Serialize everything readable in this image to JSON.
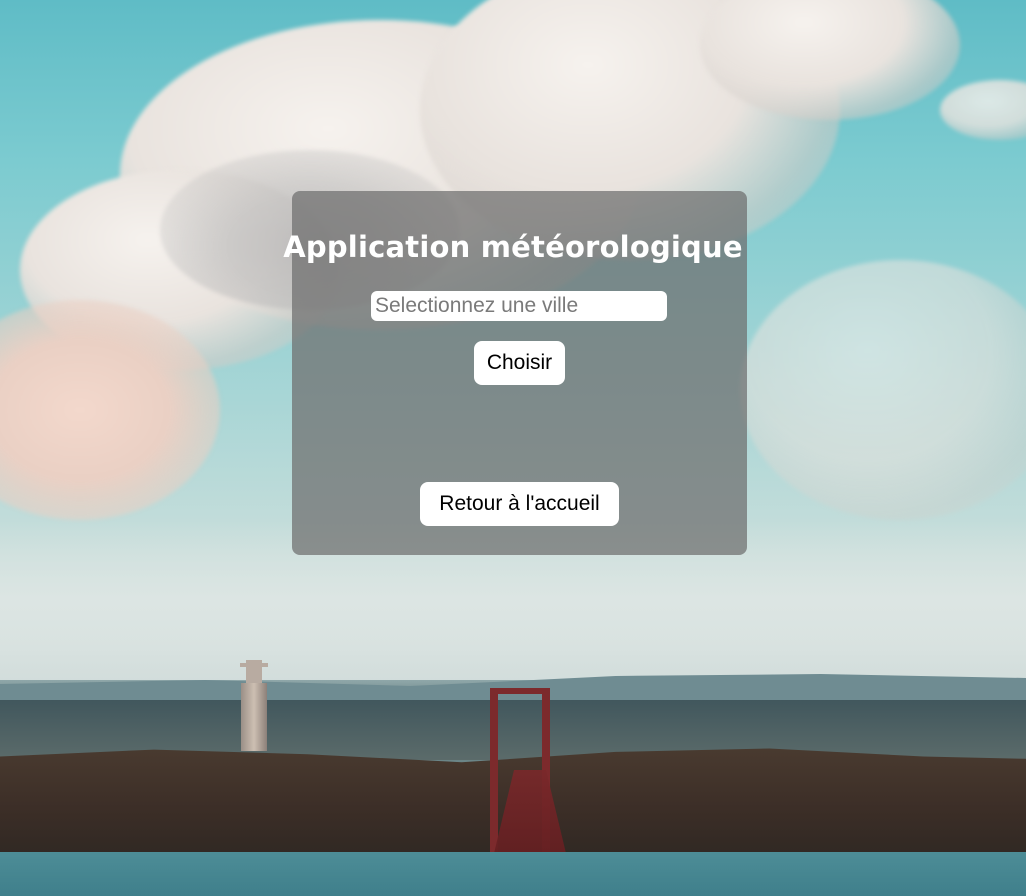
{
  "app": {
    "title": "Application météorologique"
  },
  "search": {
    "placeholder": "Selectionnez une ville",
    "value": ""
  },
  "actions": {
    "choose_label": "Choisir",
    "home_label": "Retour à l'accueil"
  },
  "colors": {
    "panel_overlay": "#6e6e6e",
    "button_bg": "#ffffff",
    "title_text": "#ffffff"
  }
}
